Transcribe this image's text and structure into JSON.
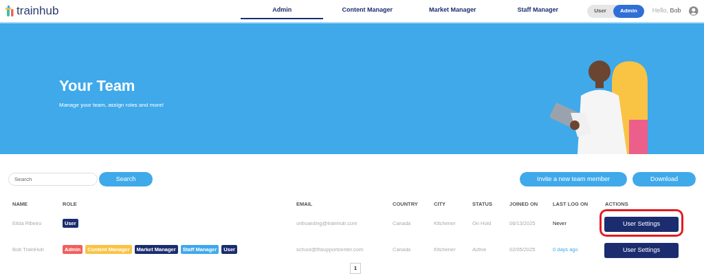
{
  "header": {
    "logo": "trainhub",
    "nav": [
      {
        "label": "Admin",
        "selected": true
      },
      {
        "label": "Content Manager",
        "selected": false
      },
      {
        "label": "Market Manager",
        "selected": false
      },
      {
        "label": "Staff Manager",
        "selected": false
      }
    ],
    "mode_toggle": [
      {
        "label": "User",
        "selected": false
      },
      {
        "label": "Admin",
        "selected": true
      }
    ],
    "greeting": "Hello,",
    "user_name": "Bob"
  },
  "banner": {
    "title": "Your Team",
    "subtitle": "Manage your team, assign roles and more!"
  },
  "toolbar": {
    "search": {
      "placeholder": "Search"
    },
    "search_button": "Search",
    "invite_button": "Invite a new team member",
    "download_button": "Download"
  },
  "table": {
    "columns": [
      "NAME",
      "ROLE",
      "EMAIL",
      "COUNTRY",
      "CITY",
      "STATUS",
      "JOINED ON",
      "LAST LOG ON",
      "ACTIONS"
    ],
    "rows": [
      {
        "name": "Elida Ribeiro",
        "roles": [
          {
            "label": "User",
            "color": "#1b2d6e"
          }
        ],
        "email": "onboarding@trainhub.com",
        "country": "Canada",
        "city": "Kitchener",
        "status": "On Hold",
        "joined_on": "06/13/2025",
        "last_log_on": {
          "text": "Never",
          "kind": "plain"
        },
        "action": "User Settings",
        "highlighted": true
      },
      {
        "name": "Bob TrainHub",
        "roles": [
          {
            "label": "Admin",
            "color": "#f0605d"
          },
          {
            "label": "Content Manager",
            "color": "#f9c344"
          },
          {
            "label": "Market Manager",
            "color": "#1b2d6e"
          },
          {
            "label": "Staff Manager",
            "color": "#3fa9ea"
          },
          {
            "label": "User",
            "color": "#1b2d6e"
          }
        ],
        "email": "school@thsupportcenter.com",
        "country": "Canada",
        "city": "Kitchener",
        "status": "Active",
        "joined_on": "02/05/2025",
        "last_log_on": {
          "text": "0 days ago",
          "kind": "link"
        },
        "action": "User Settings",
        "highlighted": false
      }
    ]
  },
  "pagination": [
    {
      "label": "1",
      "selected": true
    }
  ]
}
